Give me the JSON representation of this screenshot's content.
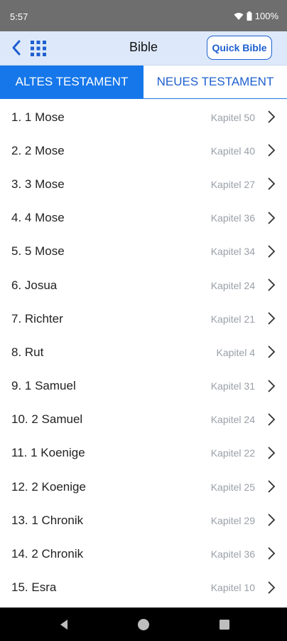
{
  "status": {
    "time": "5:57",
    "battery": "100%"
  },
  "appbar": {
    "title": "Bible",
    "quick_label": "Quick Bible"
  },
  "tabs": [
    {
      "label": "ALTES TESTAMENT",
      "active": true
    },
    {
      "label": "NEUES TESTAMENT",
      "active": false
    }
  ],
  "books": [
    {
      "name": "1. 1 Mose",
      "chapters": "Kapitel 50"
    },
    {
      "name": "2. 2 Mose",
      "chapters": "Kapitel 40"
    },
    {
      "name": "3. 3 Mose",
      "chapters": "Kapitel 27"
    },
    {
      "name": "4. 4 Mose",
      "chapters": "Kapitel 36"
    },
    {
      "name": "5. 5 Mose",
      "chapters": "Kapitel 34"
    },
    {
      "name": "6. Josua",
      "chapters": "Kapitel 24"
    },
    {
      "name": "7. Richter",
      "chapters": "Kapitel 21"
    },
    {
      "name": "8. Rut",
      "chapters": "Kapitel 4"
    },
    {
      "name": "9. 1 Samuel",
      "chapters": "Kapitel 31"
    },
    {
      "name": "10. 2 Samuel",
      "chapters": "Kapitel 24"
    },
    {
      "name": "11. 1 Koenige",
      "chapters": "Kapitel 22"
    },
    {
      "name": "12. 2 Koenige",
      "chapters": "Kapitel 25"
    },
    {
      "name": "13. 1 Chronik",
      "chapters": "Kapitel 29"
    },
    {
      "name": "14. 2 Chronik",
      "chapters": "Kapitel 36"
    },
    {
      "name": "15. Esra",
      "chapters": "Kapitel 10"
    }
  ],
  "icons": {
    "back": "back-chevron-icon",
    "grid": "grid-menu-icon",
    "row_chevron": "chevron-right-icon",
    "wifi": "wifi-icon",
    "battery": "battery-icon",
    "nav_back": "nav-back-icon",
    "nav_home": "nav-home-icon",
    "nav_recents": "nav-recents-icon"
  },
  "colors": {
    "accent": "#1677ea",
    "appbar_bg": "#dde9fb",
    "status_bg": "#6e6e6e"
  }
}
